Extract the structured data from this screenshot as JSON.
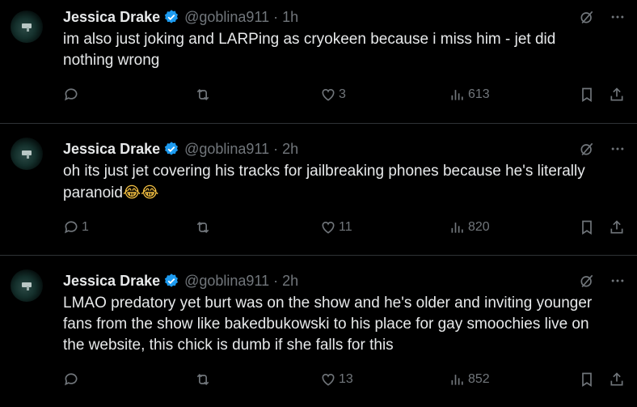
{
  "tweets": [
    {
      "name": "Jessica Drake",
      "handle": "@goblina911",
      "separator": "·",
      "time": "1h",
      "text": "im also just joking and LARPing as cryokeen because i miss him - jet did nothing wrong",
      "emoji": "",
      "replies": "",
      "reposts": "",
      "likes": "3",
      "views": "613"
    },
    {
      "name": "Jessica Drake",
      "handle": "@goblina911",
      "separator": "·",
      "time": "2h",
      "text": "oh its just jet covering his tracks for jailbreaking phones because he's literally paranoid",
      "emoji": "😂😂",
      "replies": "1",
      "reposts": "",
      "likes": "11",
      "views": "820"
    },
    {
      "name": "Jessica Drake",
      "handle": "@goblina911",
      "separator": "·",
      "time": "2h",
      "text": "LMAO predatory yet burt was on the show and he's older and inviting younger fans from the show like bakedbukowski to his place for gay smoochies live on the website, this chick is dumb if she falls for this",
      "emoji": "",
      "replies": "",
      "reposts": "",
      "likes": "13",
      "views": "852"
    }
  ],
  "icons": {
    "verified": "verified-badge-icon",
    "grok": "grok-icon",
    "more": "more-icon",
    "reply": "reply-icon",
    "repost": "repost-icon",
    "like": "heart-icon",
    "views": "views-icon",
    "bookmark": "bookmark-icon",
    "share": "share-icon"
  },
  "colors": {
    "background": "#000000",
    "text": "#e7e9ea",
    "muted": "#71767b",
    "verified": "#1d9bf0",
    "divider": "#2f3336"
  }
}
